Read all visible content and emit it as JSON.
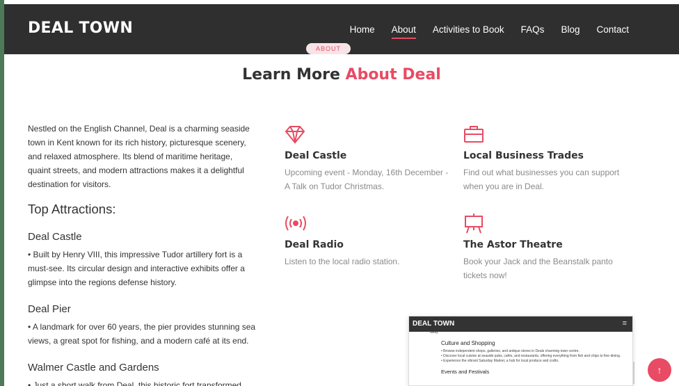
{
  "header": {
    "logo": "DEAL TOWN",
    "nav": [
      "Home",
      "About",
      "Activities to Book",
      "FAQs",
      "Blog",
      "Contact"
    ],
    "active": "About"
  },
  "section": {
    "badge": "ABOUT",
    "title_plain": "Learn More",
    "title_accent": "About Deal"
  },
  "intro": "Nestled on the English Channel, Deal is a charming seaside town in Kent known for its rich history, picturesque scenery, and relaxed atmosphere. Its blend of maritime heritage, quaint streets, and modern attractions makes it a delightful destination for visitors.",
  "top_attractions": {
    "heading": "Top Attractions:",
    "items": [
      {
        "title": "Deal Castle",
        "desc": "•  Built by Henry VIII, this impressive Tudor artillery fort is a must-see. Its circular design and interactive exhibits offer a glimpse into the regions defense history."
      },
      {
        "title": "Deal Pier",
        "desc": "•  A landmark for over 60 years, the pier provides stunning sea views, a great spot for fishing, and a modern café at its end."
      },
      {
        "title": "Walmer Castle and Gardens",
        "desc": "•  Just a short walk from Deal, this historic fort transformed"
      }
    ]
  },
  "cards": [
    {
      "icon": "diamond-icon",
      "title": "Deal Castle",
      "desc": "Upcoming event - Monday, 16th December - A Talk on Tudor Christmas."
    },
    {
      "icon": "briefcase-icon",
      "title": "Local Business Trades",
      "desc": "Find out what businesses you can support when you are in Deal."
    },
    {
      "icon": "radio-icon",
      "title": "Deal Radio",
      "desc": "Listen to the local radio station."
    },
    {
      "icon": "easel-icon",
      "title": "The Astor Theatre",
      "desc": "Book your Jack and the Beanstalk panto tickets now!"
    }
  ],
  "preview": {
    "logo": "DEAL TOWN",
    "menu_glyph": "≡",
    "cut_line": "away.",
    "heading1": "Culture and Shopping",
    "items": [
      "•  Browse independent shops, galleries, and antique stores in Deals charming town centre.",
      "•  Discover local cuisine at seaside pubs, cafés, and restaurants, offering everything from fish and chips to fine dining.",
      "•  Experience the vibrant Saturday Market, a hub for local produce and crafts."
    ],
    "heading2": "Events and Festivals"
  },
  "to_top_glyph": "↑",
  "colors": {
    "accent": "#e84b63",
    "header_bg": "#2f2f2f",
    "page_border": "#4d7a57"
  }
}
